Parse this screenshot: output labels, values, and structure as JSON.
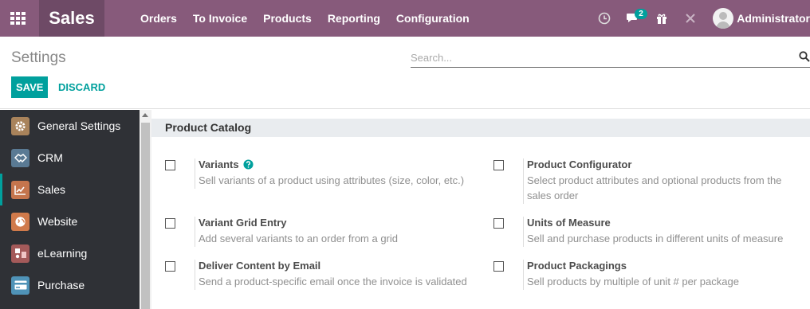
{
  "topbar": {
    "apps_icon": "grid-icon",
    "brand": "Sales",
    "menu": [
      "Orders",
      "To Invoice",
      "Products",
      "Reporting",
      "Configuration"
    ],
    "systray": {
      "activity_icon": "clock-icon",
      "messages_icon": "chat-icon",
      "messages_badge": "2",
      "gift_icon": "gift-icon",
      "debug_icon": "tools-icon"
    },
    "user": {
      "name": "Administrator",
      "avatar_icon": "user-avatar-icon"
    }
  },
  "control": {
    "title": "Settings",
    "search_placeholder": "Search...",
    "search_icon": "magnifier-icon",
    "save_label": "SAVE",
    "discard_label": "DISCARD"
  },
  "sidebar": {
    "items": [
      {
        "label": "General Settings",
        "icon": "gear-app-icon",
        "color": "#a9835b",
        "active": false
      },
      {
        "label": "CRM",
        "icon": "handshake-app-icon",
        "color": "#5a7a94",
        "active": false
      },
      {
        "label": "Sales",
        "icon": "chart-up-app-icon",
        "color": "#c5754d",
        "active": true
      },
      {
        "label": "Website",
        "icon": "globe-app-icon",
        "color": "#d07a4b",
        "active": false
      },
      {
        "label": "eLearning",
        "icon": "education-app-icon",
        "color": "#a45a5a",
        "active": false
      },
      {
        "label": "Purchase",
        "icon": "card-app-icon",
        "color": "#4f93b8",
        "active": false
      }
    ]
  },
  "section": {
    "title": "Product Catalog",
    "settings": [
      {
        "title": "Variants",
        "description": "Sell variants of a product using attributes (size, color, etc.)",
        "help_icon": "question-circle-icon",
        "checked": false
      },
      {
        "title": "Product Configurator",
        "description": "Select product attributes and optional products from the sales order",
        "checked": false
      },
      {
        "title": "Variant Grid Entry",
        "description": "Add several variants to an order from a grid",
        "checked": false
      },
      {
        "title": "Units of Measure",
        "description": "Sell and purchase products in different units of measure",
        "checked": false
      },
      {
        "title": "Deliver Content by Email",
        "description": "Send a product-specific email once the invoice is validated",
        "checked": false
      },
      {
        "title": "Product Packagings",
        "description": "Sell products by multiple of unit # per package",
        "checked": false
      }
    ]
  },
  "colors": {
    "topbar": "#875a7b",
    "brand_bg": "#6e4a66",
    "accent": "#00a09d",
    "sidebar_bg": "#2f3136"
  }
}
